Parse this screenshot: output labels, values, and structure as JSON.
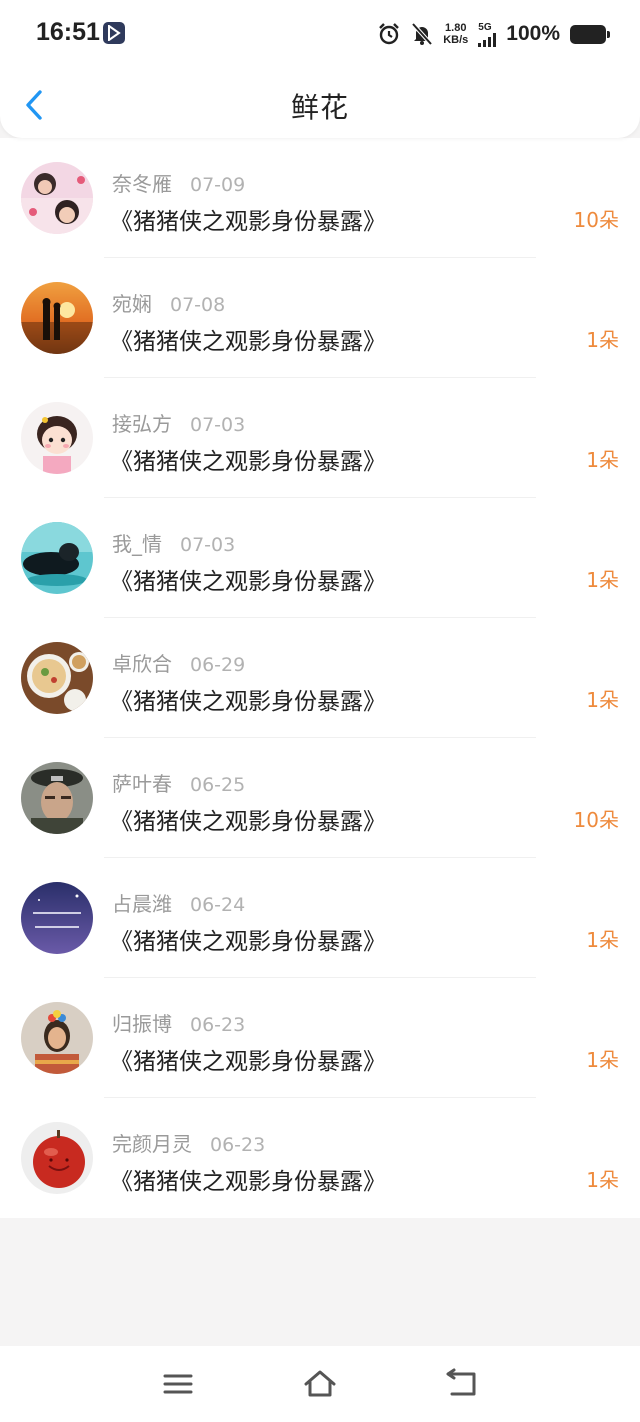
{
  "status_bar": {
    "time": "16:51",
    "net_speed_value": "1.80",
    "net_speed_unit": "KB/s",
    "network": "5G",
    "battery": "100%"
  },
  "header": {
    "title": "鲜花"
  },
  "colors": {
    "accent_back": "#2196f3",
    "count": "#ee8a3c",
    "name": "#9a9a9a",
    "date": "#b2b2b2"
  },
  "items": [
    {
      "name": "奈冬雁",
      "date": "07-09",
      "title": "《猪猪侠之观影身份暴露》",
      "count": "10朵"
    },
    {
      "name": "宛娴",
      "date": "07-08",
      "title": "《猪猪侠之观影身份暴露》",
      "count": "1朵"
    },
    {
      "name": "接弘方",
      "date": "07-03",
      "title": "《猪猪侠之观影身份暴露》",
      "count": "1朵"
    },
    {
      "name": "我_情",
      "date": "07-03",
      "title": "《猪猪侠之观影身份暴露》",
      "count": "1朵"
    },
    {
      "name": "卓欣合",
      "date": "06-29",
      "title": "《猪猪侠之观影身份暴露》",
      "count": "1朵"
    },
    {
      "name": "萨叶春",
      "date": "06-25",
      "title": "《猪猪侠之观影身份暴露》",
      "count": "10朵"
    },
    {
      "name": "占晨潍",
      "date": "06-24",
      "title": "《猪猪侠之观影身份暴露》",
      "count": "1朵"
    },
    {
      "name": "归振博",
      "date": "06-23",
      "title": "《猪猪侠之观影身份暴露》",
      "count": "1朵"
    },
    {
      "name": "完颜月灵",
      "date": "06-23",
      "title": "《猪猪侠之观影身份暴露》",
      "count": "1朵"
    }
  ],
  "nav": {
    "menu_icon": "menu-icon",
    "home_icon": "home-icon",
    "back_icon": "back-icon"
  }
}
